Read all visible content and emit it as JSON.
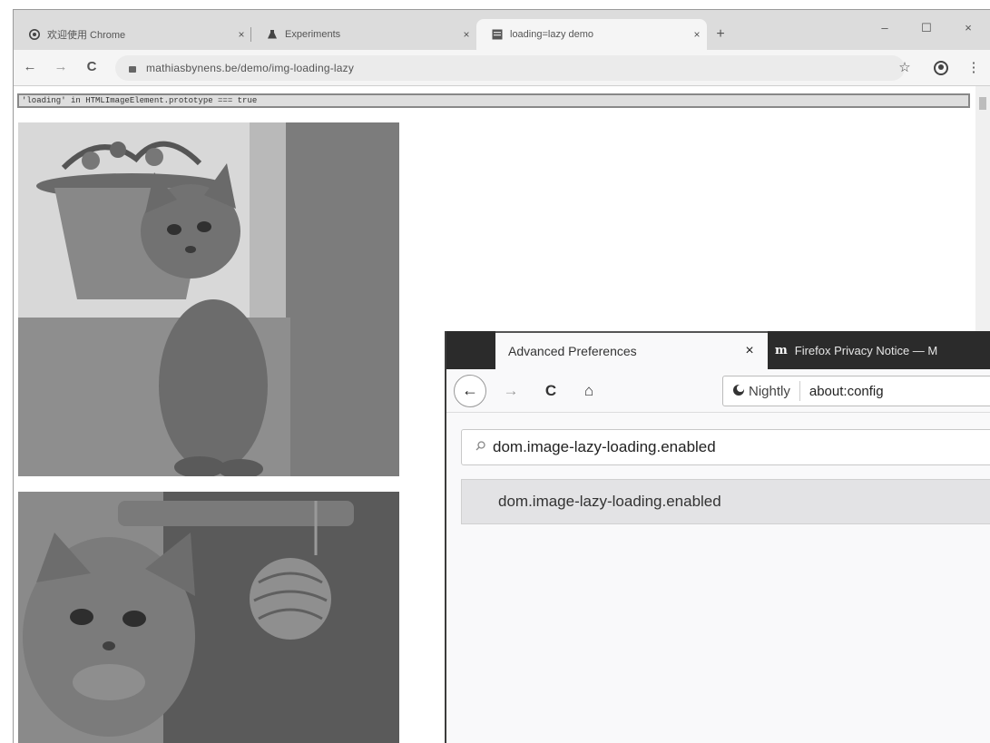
{
  "chrome": {
    "tabs": [
      {
        "label": "欢迎使用 Chrome",
        "icon": "chrome-logo-icon",
        "close": "×"
      },
      {
        "label": "Experiments",
        "icon": "flask-icon",
        "close": "×"
      },
      {
        "label": "loading=lazy demo",
        "icon": "page-favicon-icon",
        "close": "×",
        "active": true
      }
    ],
    "new_tab": "+",
    "window_controls": {
      "minimize": "–",
      "maximize": "☐",
      "close": "×"
    },
    "toolbar": {
      "back": "←",
      "forward": "→",
      "reload": "C",
      "url": "mathiasbynens.be/demo/img-loading-lazy",
      "bookmark": "☆",
      "menu": "⋮"
    },
    "content": {
      "console_line": "'loading' in HTMLImageElement.prototype === true"
    }
  },
  "firefox": {
    "tabs": [
      {
        "label": "Advanced Preferences",
        "close": "×"
      },
      {
        "label": "Firefox Privacy Notice — M",
        "icon_letter": "m"
      }
    ],
    "nav": {
      "back": "←",
      "forward": "→",
      "reload": "C",
      "home": "⌂",
      "identity": "Nightly",
      "url": "about:config"
    },
    "search_value": "dom.image-lazy-loading.enabled",
    "result_row": "dom.image-lazy-loading.enabled"
  }
}
